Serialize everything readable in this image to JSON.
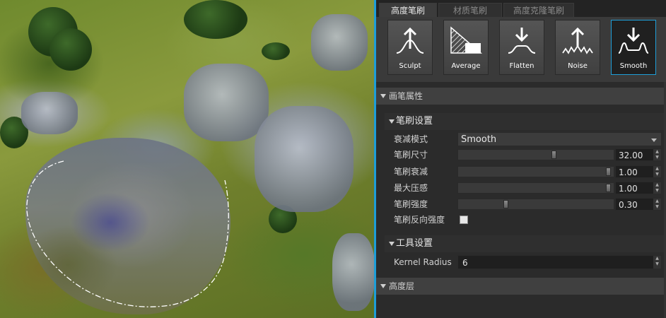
{
  "tabs": [
    {
      "label": "高度笔刷",
      "active": true
    },
    {
      "label": "材质笔刷",
      "active": false
    },
    {
      "label": "高度克隆笔刷",
      "active": false
    }
  ],
  "tools": [
    {
      "label": "Sculpt",
      "icon": "sculpt-icon",
      "selected": false
    },
    {
      "label": "Average",
      "icon": "average-icon",
      "selected": false
    },
    {
      "label": "Flatten",
      "icon": "flatten-icon",
      "selected": false
    },
    {
      "label": "Noise",
      "icon": "noise-icon",
      "selected": false
    },
    {
      "label": "Smooth",
      "icon": "smooth-icon",
      "selected": true
    }
  ],
  "brush_properties": {
    "header": "画笔属性",
    "brush_settings": {
      "header": "笔刷设置",
      "falloff_mode": {
        "label": "衰减模式",
        "value": "Smooth"
      },
      "brush_size": {
        "label": "笔刷尺寸",
        "value": "32.00",
        "fraction": 0.62
      },
      "brush_falloff": {
        "label": "笔刷衰减",
        "value": "1.00",
        "fraction": 0.98
      },
      "max_pressure": {
        "label": "最大压感",
        "value": "1.00",
        "fraction": 0.98
      },
      "brush_strength": {
        "label": "笔刷强度",
        "value": "0.30",
        "fraction": 0.3
      },
      "brush_invert": {
        "label": "笔刷反向强度",
        "checked": false
      }
    },
    "tool_settings": {
      "header": "工具设置",
      "kernel_radius": {
        "label": "Kernel Radius",
        "value": "6"
      }
    }
  },
  "height_layers": {
    "header": "高度层"
  },
  "colors": {
    "accent": "#1e9ed8",
    "panel_bg": "#2b2b2b"
  }
}
